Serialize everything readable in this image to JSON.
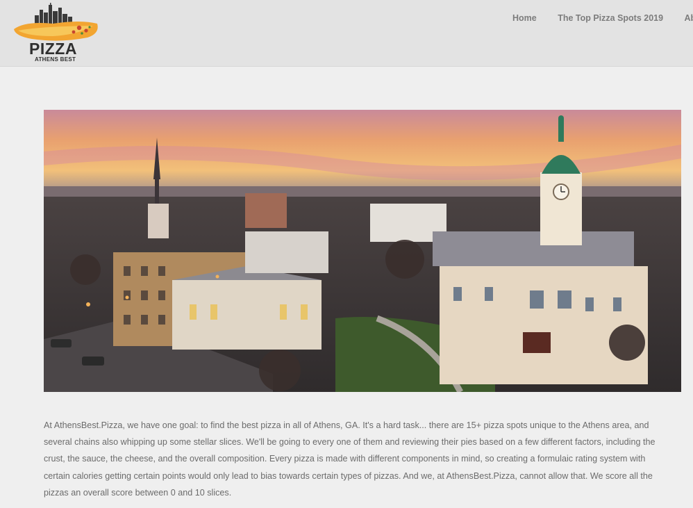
{
  "site": {
    "logo_word": "PIZZA",
    "logo_sub": "ATHENS BEST"
  },
  "nav": {
    "items": [
      {
        "label": "Home"
      },
      {
        "label": "The Top Pizza Spots 2019"
      },
      {
        "label": "Abo"
      }
    ]
  },
  "hero": {
    "alt": "Aerial view of downtown Athens, GA at sunset with the domed city hall and church steeple"
  },
  "main": {
    "intro": "At AthensBest.Pizza, we have one goal: to find the best pizza in all of Athens, GA. It's a hard task... there are 15+ pizza spots unique to the Athens area, and several chains also whipping up some stellar slices. We'll be going to every one of them and reviewing their pies based on a few different factors, including the crust, the sauce, the cheese, and the overall composition.  Every pizza is made with different components in mind, so creating a formulaic rating system with certain calories getting certain points would only lead to bias towards certain types of pizzas.  And we, at AthensBest.Pizza, cannot allow that.  We score all the pizzas an overall score between 0 and 10 slices."
  },
  "colors": {
    "header_bg": "#e3e3e3",
    "page_bg": "#efefef",
    "nav_text": "#7c7c7c",
    "body_text": "#6b6b6b",
    "logo_orange": "#f2a531"
  }
}
